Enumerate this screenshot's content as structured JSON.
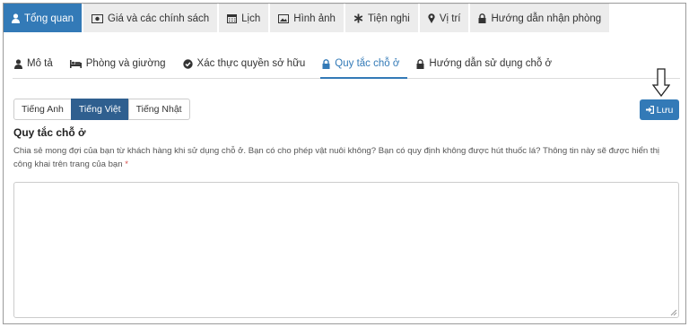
{
  "top_tabs": [
    {
      "label": "Tổng quan",
      "icon": "user-icon",
      "active": true
    },
    {
      "label": "Giá và các chính sách",
      "icon": "money-icon",
      "active": false
    },
    {
      "label": "Lịch",
      "icon": "calendar-icon",
      "active": false
    },
    {
      "label": "Hình ảnh",
      "icon": "image-icon",
      "active": false
    },
    {
      "label": "Tiện nghi",
      "icon": "asterisk-icon",
      "active": false
    },
    {
      "label": "Vị trí",
      "icon": "map-marker-icon",
      "active": false
    },
    {
      "label": "Hướng dẫn nhận phòng",
      "icon": "lock-icon",
      "active": false
    }
  ],
  "sub_tabs": [
    {
      "label": "Mô tả",
      "icon": "user-icon",
      "active": false
    },
    {
      "label": "Phòng và giường",
      "icon": "bed-icon",
      "active": false
    },
    {
      "label": "Xác thực quyền sở hữu",
      "icon": "check-circle-icon",
      "active": false
    },
    {
      "label": "Quy tắc chỗ ở",
      "icon": "lock-icon",
      "active": true
    },
    {
      "label": "Hướng dẫn sử dụng chỗ ở",
      "icon": "lock-icon",
      "active": false
    }
  ],
  "languages": [
    {
      "label": "Tiếng Anh",
      "active": false
    },
    {
      "label": "Tiếng Việt",
      "active": true
    },
    {
      "label": "Tiếng Nhật",
      "active": false
    }
  ],
  "save_label": "Lưu",
  "form": {
    "title": "Quy tắc chỗ ở",
    "description": "Chia sẻ mong đợi của bạn từ khách hàng khi sử dụng chỗ ở. Bạn có cho phép vật nuôi không? Bạn có quy định không được hút thuốc lá? Thông tin này sẽ được hiển thị công khai trên trang của bạn",
    "required_mark": "*",
    "value": ""
  },
  "colors": {
    "accent": "#337ab7",
    "lang_active": "#2f5f8f",
    "required": "#d9534f"
  }
}
